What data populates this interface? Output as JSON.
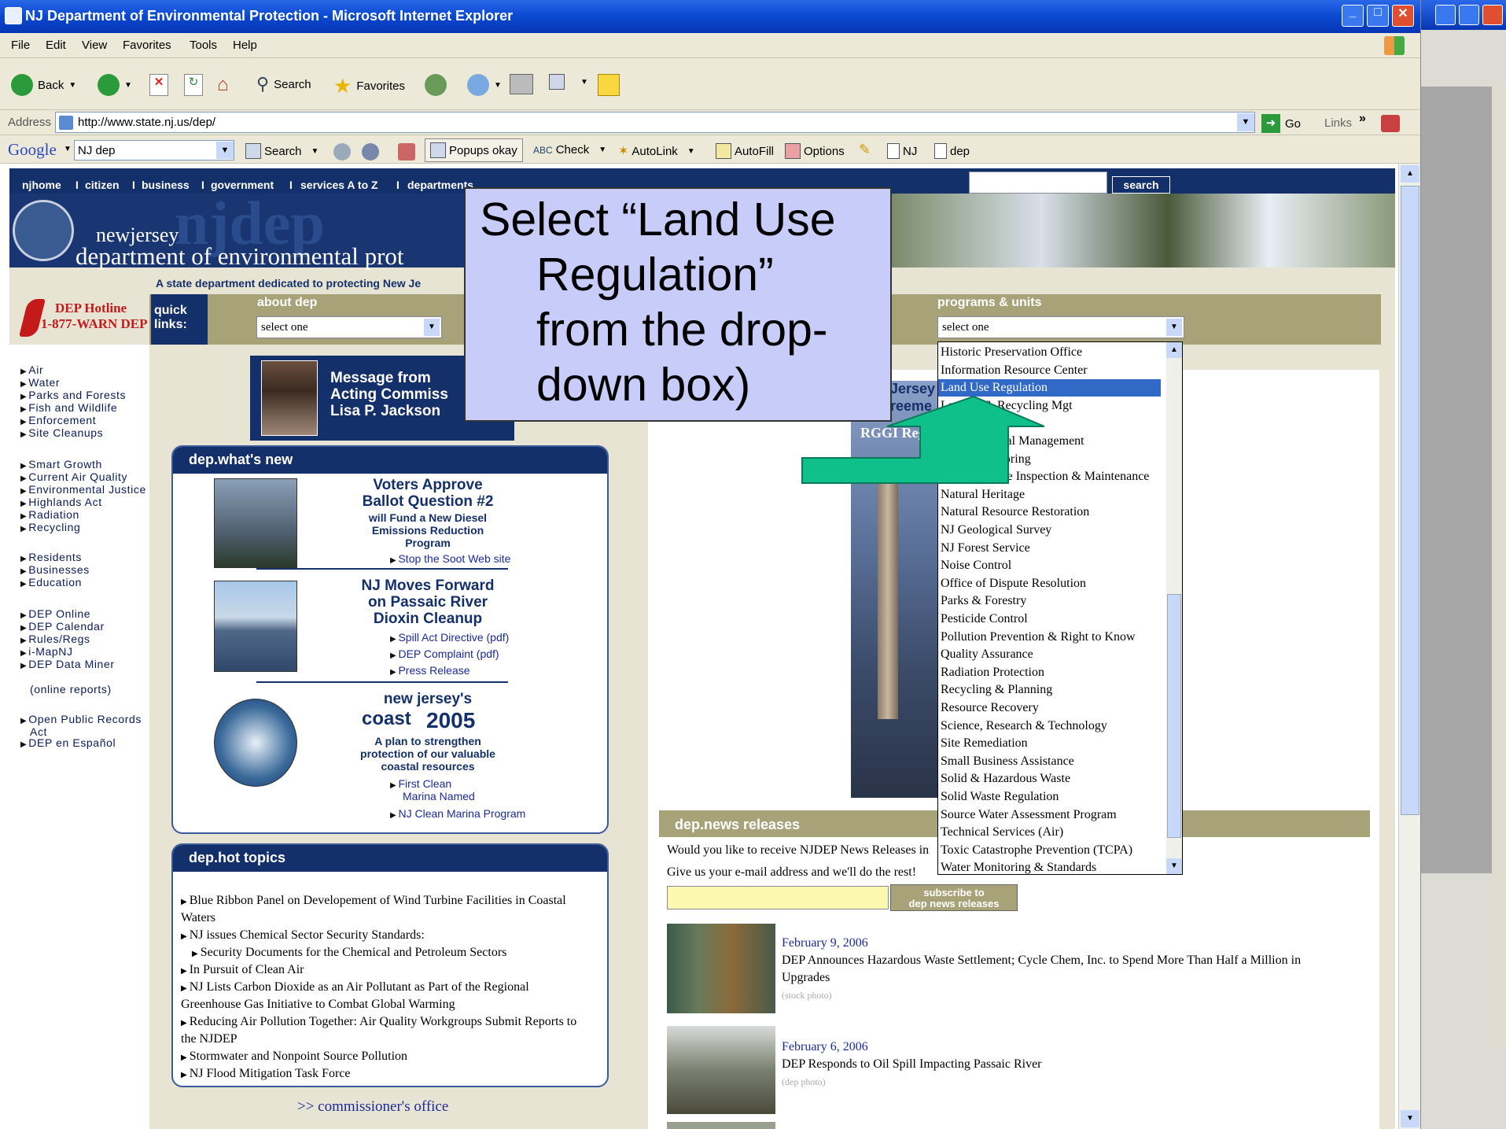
{
  "window": {
    "title": "NJ Department of Environmental Protection - Microsoft Internet Explorer"
  },
  "menu": [
    "File",
    "Edit",
    "View",
    "Favorites",
    "Tools",
    "Help"
  ],
  "toolbar": {
    "back": "Back",
    "search": "Search",
    "favorites": "Favorites"
  },
  "address": {
    "label": "Address",
    "url": "http://www.state.nj.us/dep/",
    "go": "Go",
    "links": "Links"
  },
  "google": {
    "logo": "Google",
    "query": "NJ dep",
    "search": "Search",
    "popups": "Popups okay",
    "check": "Check",
    "autolink": "AutoLink",
    "autofill": "AutoFill",
    "options": "Options",
    "btn_nj": "NJ",
    "btn_dep": "dep"
  },
  "site": {
    "nav": [
      "njhome",
      "citizen",
      "business",
      "government",
      "services A to Z",
      "departments"
    ],
    "search_button": "search",
    "logo_small": "newjersey",
    "logo_big": "njdep",
    "logo_dept": "department of environmental prot",
    "tagline": "A state department dedicated to protecting New Je",
    "hotline_1": "DEP Hotline",
    "hotline_2": "1-877-WARN DEP",
    "quick_links": "quick links:",
    "about_label": "about dep",
    "select_one": "select one",
    "programs_label": "programs & units",
    "message_1": "Message from",
    "message_2": "Acting Commiss",
    "message_3": "Lisa P. Jackson",
    "jersey_1": "Jersey",
    "jersey_2": "reeme",
    "rggi": "RGGI Regi",
    "whats_new": "dep.what's new",
    "hot_topics": "dep.hot topics",
    "news_releases": "dep.news releases",
    "commissioner": ">> commissioner's office",
    "newsletter_1": "Would you like to receive NJDEP News Releases in",
    "newsletter_2": "Give us your e-mail address and we'll do the rest!",
    "subscribe_1": "subscribe to",
    "subscribe_2": "dep news releases"
  },
  "left_groups": [
    [
      "Air",
      "Water",
      "Parks and Forests",
      "Fish and Wildlife",
      "Enforcement",
      "Site Cleanups"
    ],
    [
      "Smart Growth",
      "Current Air Quality",
      "Environmental Justice",
      "Highlands Act",
      "Radiation",
      "Recycling"
    ],
    [
      "Residents",
      "Businesses",
      "Education"
    ],
    [
      "DEP Online",
      "DEP Calendar",
      "Rules/Regs",
      "i-MapNJ",
      "DEP Data Miner"
    ]
  ],
  "left_extra": {
    "miner_sub": "(online reports)",
    "opra_1": "Open Public Records",
    "opra_2": "Act",
    "espanol": "DEP en Español"
  },
  "whats_new_items": {
    "i1": {
      "t1": "Voters Approve",
      "t2": "Ballot Question #2",
      "d1": "will Fund a New Diesel",
      "d2": "Emissions Reduction",
      "d3": "Program",
      "link": "Stop the Soot Web site"
    },
    "i2": {
      "t1": "NJ Moves Forward",
      "t2": "on Passaic River",
      "t3": "Dioxin Cleanup",
      "l1": "Spill Act Directive (pdf)",
      "l2": "DEP Complaint (pdf)",
      "l3": "Press Release"
    },
    "i3": {
      "t1": "new jersey's",
      "t2": "coast",
      "t3": "2005",
      "d1": "A plan to strengthen",
      "d2": "protection of our valuable",
      "d3": "coastal resources",
      "l1": "First Clean",
      "l1b": "Marina Named",
      "l2": "NJ Clean Marina Program"
    }
  },
  "hot_topics_items": [
    "Blue Ribbon Panel on Developement of Wind Turbine Facilities in Coastal",
    "Waters",
    "NJ issues Chemical Sector Security Standards:",
    "Security Documents for the Chemical and Petroleum Sectors",
    "In Pursuit of Clean Air",
    "NJ Lists Carbon Dioxide as an Air Pollutant as Part of the Regional",
    "Greenhouse Gas Initiative to Combat Global Warming",
    "Reducing Air Pollution Together: Air Quality Workgroups Submit Reports to",
    "the NJDEP",
    "Stormwater and Nonpoint Source Pollution",
    "NJ Flood Mitigation Task Force"
  ],
  "news": [
    {
      "date": "February 9, 2006",
      "text_1": "DEP Announces Hazardous Waste Settlement; Cycle Chem, Inc. to Spend More Than Half a Million in",
      "text_2": "Upgrades",
      "caption": "(stock photo)"
    },
    {
      "date": "February 6, 2006",
      "text_1": "DEP Responds to Oil Spill Impacting Passaic River",
      "text_2": "",
      "caption": "(dep photo)"
    }
  ],
  "dropdown_options": [
    "Historic Preservation Office",
    "Information Resource Center",
    "Land Use Regulation",
    "Landfill & Recycling Mgt",
    "",
    "Environmental Management",
    "Water Monitoring",
    "Motor Vehicle Inspection & Maintenance",
    "Natural Heritage",
    "Natural Resource Restoration",
    "NJ Geological Survey",
    "NJ Forest Service",
    "Noise Control",
    "Office of Dispute Resolution",
    "Parks & Forestry",
    "Pesticide Control",
    "Pollution Prevention & Right to Know",
    "Quality Assurance",
    "Radiation Protection",
    "Recycling & Planning",
    "Resource Recovery",
    "Science, Research & Technology",
    "Site Remediation",
    "Small Business Assistance",
    "Solid & Hazardous Waste",
    "Solid Waste Regulation",
    "Source Water Assessment Program",
    "Technical Services (Air)",
    "Toxic Catastrophe Prevention (TCPA)",
    "Water Monitoring & Standards"
  ],
  "callout": {
    "line1": "Select “Land Use",
    "line2": "Regulation”",
    "line3": "from the drop-",
    "line4": "down box)"
  },
  "colors": {
    "accent_navy": "#14306a",
    "olive": "#a8a278",
    "selected": "#3169c6",
    "arrow": "#10c08a",
    "callout_bg": "#c8ccf8"
  }
}
